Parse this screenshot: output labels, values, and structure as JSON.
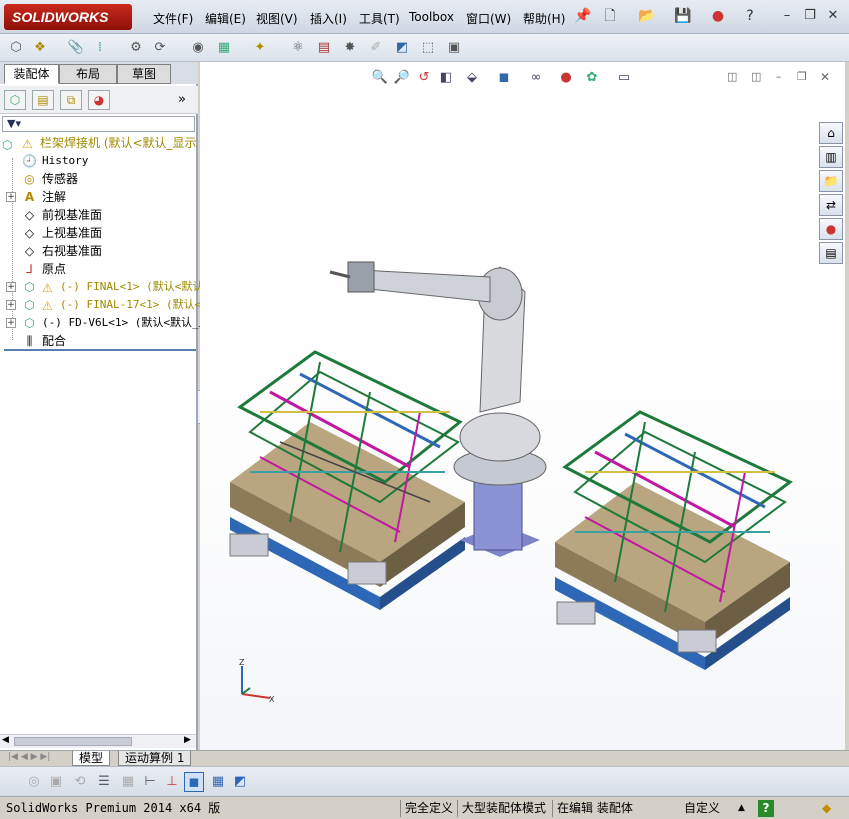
{
  "app": {
    "logo_text": "SOLIDWORKS",
    "colors": {
      "brand_red": "#b71c12",
      "tree_yellow": "#a08a00",
      "accent_blue": "#2f67b7"
    }
  },
  "menu": {
    "items": [
      "文件(F)",
      "编辑(E)",
      "视图(V)",
      "插入(I)",
      "工具(T)",
      "Toolbox",
      "窗口(W)",
      "帮助(H)"
    ]
  },
  "panel": {
    "tabs": [
      "装配体",
      "布局",
      "草图"
    ],
    "more_label": "»",
    "tree": {
      "root": "栏架焊接机  (默认<默认_显示",
      "nodes": [
        {
          "label": "History",
          "icon": "history-icon"
        },
        {
          "label": "传感器",
          "icon": "sensor-icon"
        },
        {
          "label": "注解",
          "icon": "annotation-icon"
        },
        {
          "label": "前视基准面",
          "icon": "plane-icon"
        },
        {
          "label": "上视基准面",
          "icon": "plane-icon"
        },
        {
          "label": "右视基准面",
          "icon": "plane-icon"
        },
        {
          "label": "原点",
          "icon": "origin-icon"
        },
        {
          "label": "(-) FINAL<1> (默认<默认",
          "icon": "assembly-warning-icon"
        },
        {
          "label": "(-) FINAL-17<1> (默认<默",
          "icon": "assembly-warning-icon"
        },
        {
          "label": "(-) FD-V6L<1> (默认<默认_显",
          "icon": "assembly-icon"
        },
        {
          "label": "配合",
          "icon": "mates-icon"
        }
      ]
    }
  },
  "bottom_tabs": [
    "模型",
    "运动算例 1"
  ],
  "status": {
    "version": "SolidWorks Premium 2014 x64 版",
    "definition": "完全定义",
    "mode": "大型装配体模式",
    "editing": "在编辑 装配体",
    "units": "自定义"
  }
}
